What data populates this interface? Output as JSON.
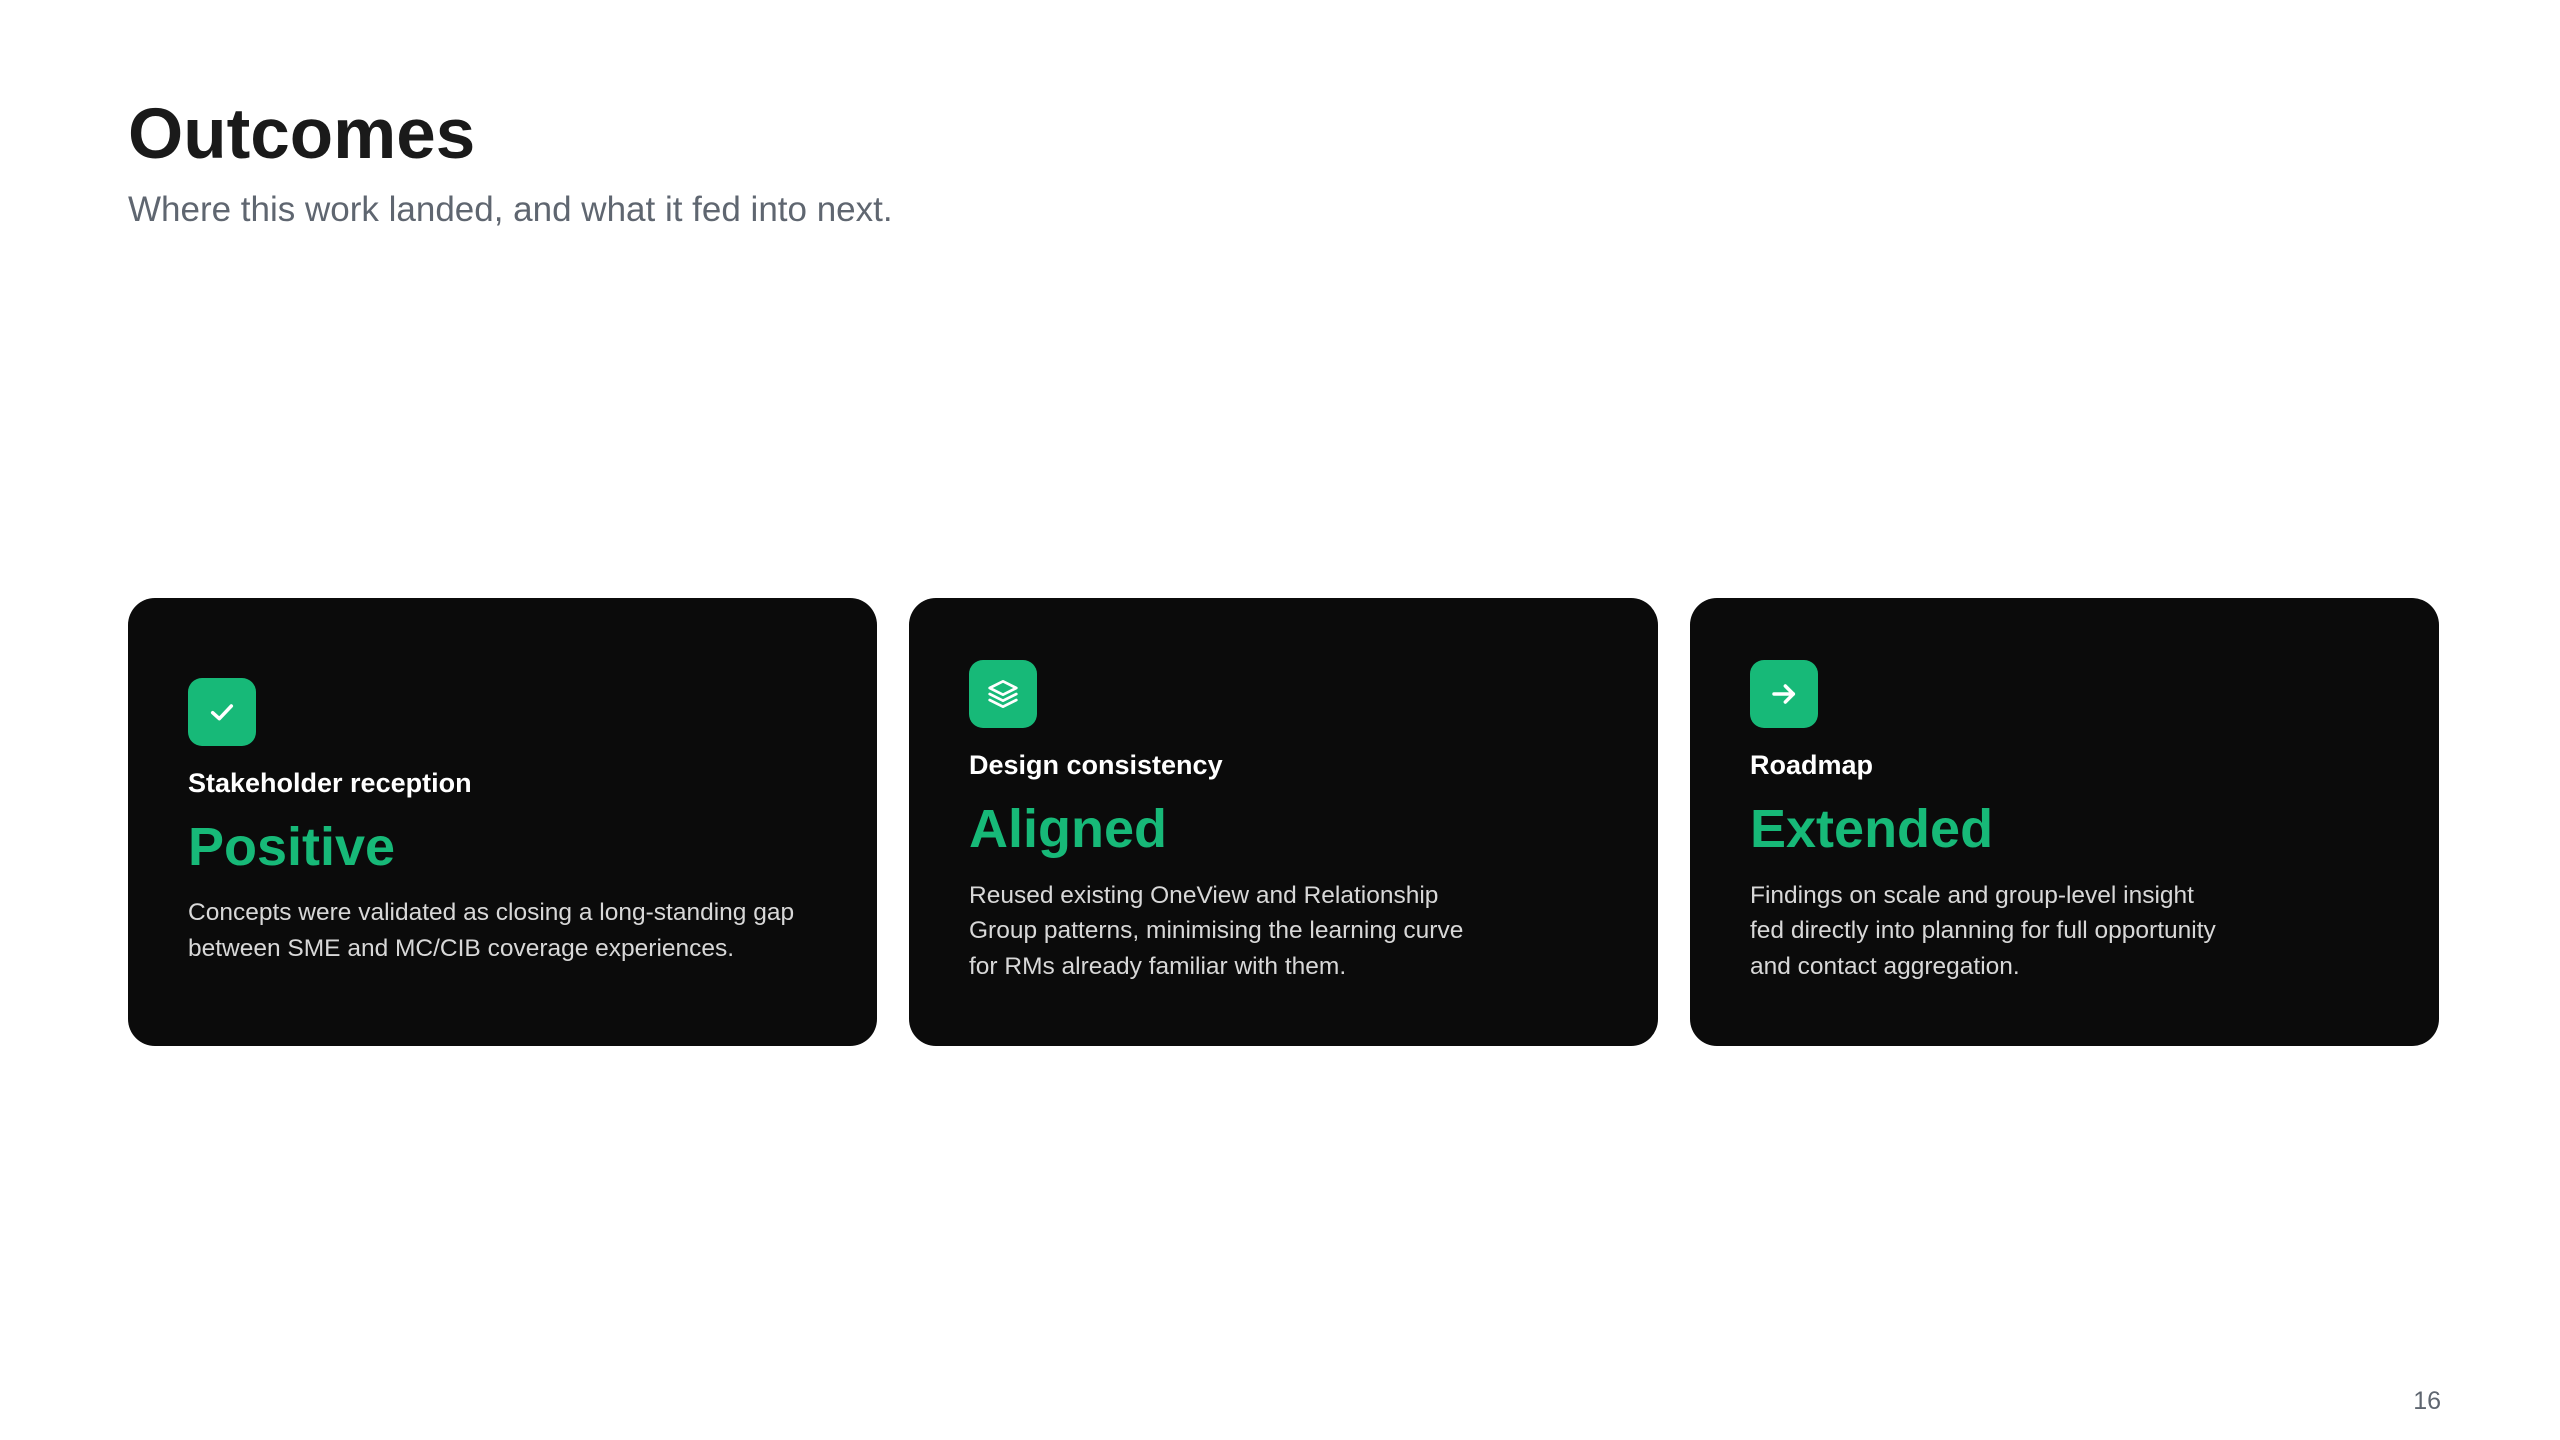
{
  "header": {
    "title": "Outcomes",
    "subtitle": "Where this work landed, and what it fed into next."
  },
  "cards": [
    {
      "icon": "check-icon",
      "label": "Stakeholder reception",
      "value": "Positive",
      "description": "Concepts were validated as closing a long-standing gap between SME and MC/CIB coverage experiences."
    },
    {
      "icon": "layers-icon",
      "label": "Design consistency",
      "value": "Aligned",
      "description": "Reused existing OneView and Relationship Group patterns, minimising the learning curve for RMs already familiar with them."
    },
    {
      "icon": "arrow-right-icon",
      "label": "Roadmap",
      "value": "Extended",
      "description": "Findings on scale and group-level insight fed directly into planning for full opportunity and contact aggregation."
    }
  ],
  "footer": {
    "page_number": "16"
  },
  "colors": {
    "accent": "#17b978",
    "card_background": "#0b0b0b",
    "page_background": "#ffffff"
  }
}
